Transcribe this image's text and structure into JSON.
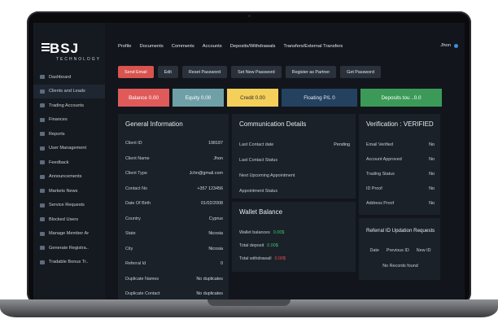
{
  "brand": {
    "name": "BSJ",
    "sub": "TECHNOLOGY"
  },
  "sidebar": {
    "items": [
      {
        "label": "Dashboard",
        "icon": "dashboard-icon"
      },
      {
        "label": "Clients and Leads",
        "icon": "users-icon"
      },
      {
        "label": "Trading Accounts",
        "icon": "chart-icon"
      },
      {
        "label": "Finances",
        "icon": "wallet-icon"
      },
      {
        "label": "Reports",
        "icon": "report-icon"
      },
      {
        "label": "User Management",
        "icon": "user-icon"
      },
      {
        "label": "Feedback",
        "icon": "feedback-icon"
      },
      {
        "label": "Announcements",
        "icon": "megaphone-icon"
      },
      {
        "label": "Markets News",
        "icon": "news-icon"
      },
      {
        "label": "Service Requests",
        "icon": "service-icon"
      },
      {
        "label": "Blocked Users",
        "icon": "block-icon"
      },
      {
        "label": "Manage Member Ar",
        "icon": "members-icon"
      },
      {
        "label": "Generate Registra..",
        "icon": "form-icon"
      },
      {
        "label": "Tradable Bonus Tr..",
        "icon": "bonus-icon"
      }
    ]
  },
  "topnav": {
    "items": [
      "Profile",
      "Documents",
      "Comments",
      "Accounts",
      "Deposits/Withdrawals",
      "Transfers/External Transfers"
    ],
    "user": "Jhon"
  },
  "actions": [
    "Send Email",
    "Edit",
    "Reset Password",
    "Set New Password",
    "Register as Partner",
    "Get Password"
  ],
  "stats": [
    {
      "label": "Balance 0.00",
      "bg": "#e05a5a",
      "fg": "#ffffff"
    },
    {
      "label": "Equity 0.00",
      "bg": "#6fa0a7",
      "fg": "#ffffff"
    },
    {
      "label": "Credit 0.00",
      "bg": "#f4cf5a",
      "fg": "#2b2b2b"
    },
    {
      "label": "Floating P/L 0",
      "bg": "#24415f",
      "fg": "#e6ecf2"
    },
    {
      "label": "Deposits tou ..0.0",
      "bg": "#3b9a58",
      "fg": "#ffffff"
    }
  ],
  "general": {
    "title": "General Information",
    "rows": [
      {
        "k": "Client ID",
        "v": "198187"
      },
      {
        "k": "Client Name",
        "v": "Jhon"
      },
      {
        "k": "Client Type",
        "v": "Jchn@gmail.com"
      },
      {
        "k": "Contact No",
        "v": "+357 123456"
      },
      {
        "k": "Date Of Birth",
        "v": "01/02/2008"
      },
      {
        "k": "Country",
        "v": "Cyprus"
      },
      {
        "k": "State",
        "v": "Nicosia"
      },
      {
        "k": "City",
        "v": "Nicosia"
      },
      {
        "k": "Referral Id",
        "v": "0"
      },
      {
        "k": "Duplicate Names",
        "v": "No duplicates"
      },
      {
        "k": "Duplicate Contact",
        "v": "No duplicates"
      }
    ]
  },
  "communication": {
    "title": "Communication Details",
    "rows": [
      {
        "k": "Last Contact date",
        "v": "Pending"
      },
      {
        "k": "Last Contact Status",
        "v": ""
      },
      {
        "k": "Next Upcoming Appointment",
        "v": ""
      },
      {
        "k": "Appointment Status",
        "v": ""
      }
    ]
  },
  "wallet": {
    "title": "Wallet Balance",
    "rows": [
      {
        "k": "Wallet balances",
        "v": "0.00$"
      },
      {
        "k": "Total deposit",
        "v": "0.00$"
      },
      {
        "k": "Total withdrawall",
        "v": "0.00$"
      }
    ]
  },
  "verification": {
    "title": "Verification : VERIFIED",
    "rows": [
      {
        "k": "Email Verified",
        "v": "No"
      },
      {
        "k": "Account Approved",
        "v": "No"
      },
      {
        "k": "Trading Status",
        "v": "No"
      },
      {
        "k": "ID Proof",
        "v": "No"
      },
      {
        "k": "Address Proof",
        "v": "No"
      }
    ]
  },
  "referral": {
    "title": "Referral ID Updation Requests",
    "headers": [
      "Date",
      "Previous ID",
      "New ID"
    ],
    "empty": "No Records found"
  }
}
